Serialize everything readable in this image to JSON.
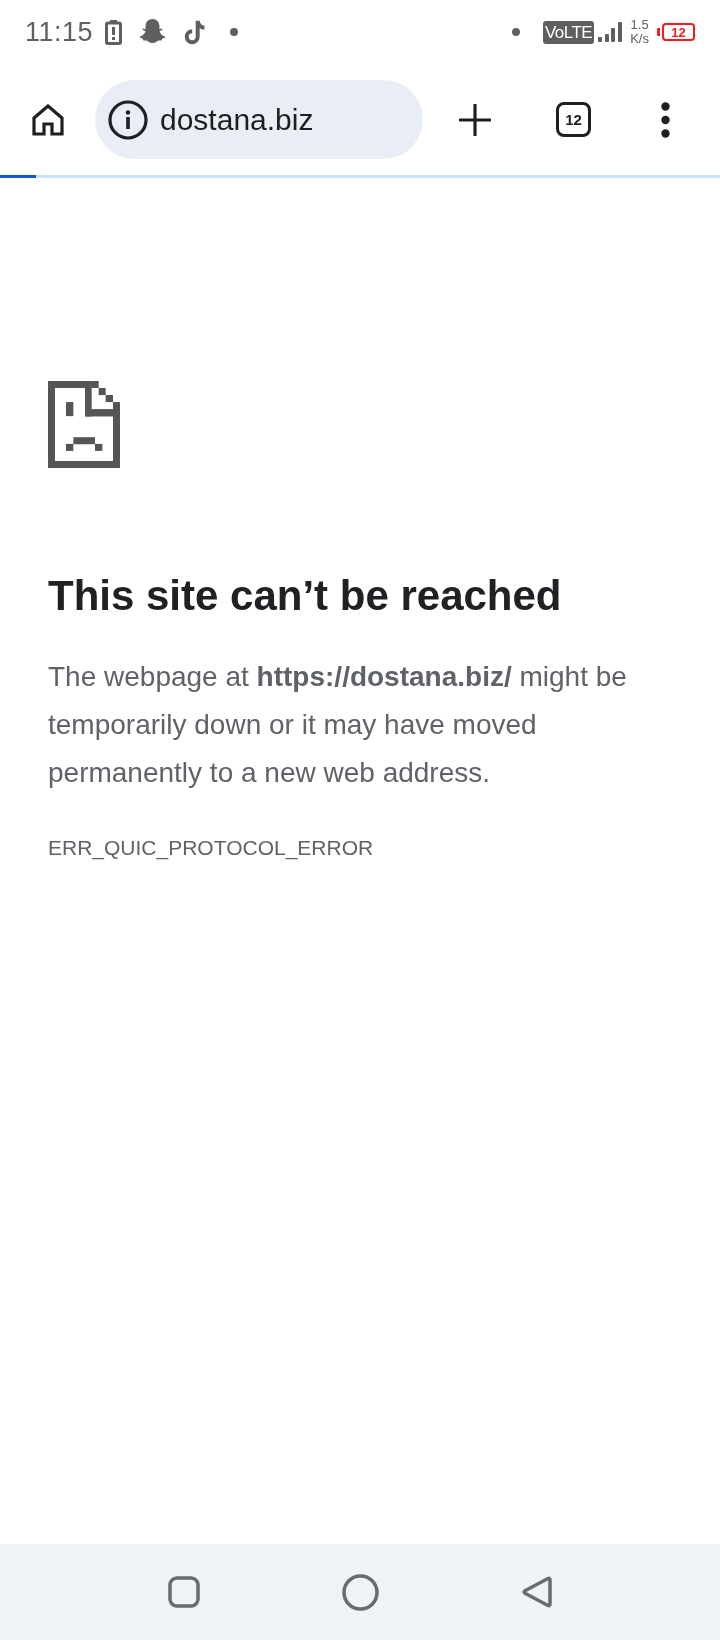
{
  "status_bar": {
    "time": "11:15",
    "network_type": "VoLTE",
    "speed": "1.5",
    "speed_unit": "K/s",
    "battery": "12",
    "battery_low": true
  },
  "toolbar": {
    "url": "dostana.biz",
    "tab_count": "12"
  },
  "page_load": {
    "level": 0.05
  },
  "error": {
    "title": "This site can’t be reached",
    "message": "The webpage at **https://dostana.biz/** might be temporarily down or it may have moved permanently to a new web address.",
    "code": "ERR_QUIC_PROTOCOL_ERROR"
  }
}
